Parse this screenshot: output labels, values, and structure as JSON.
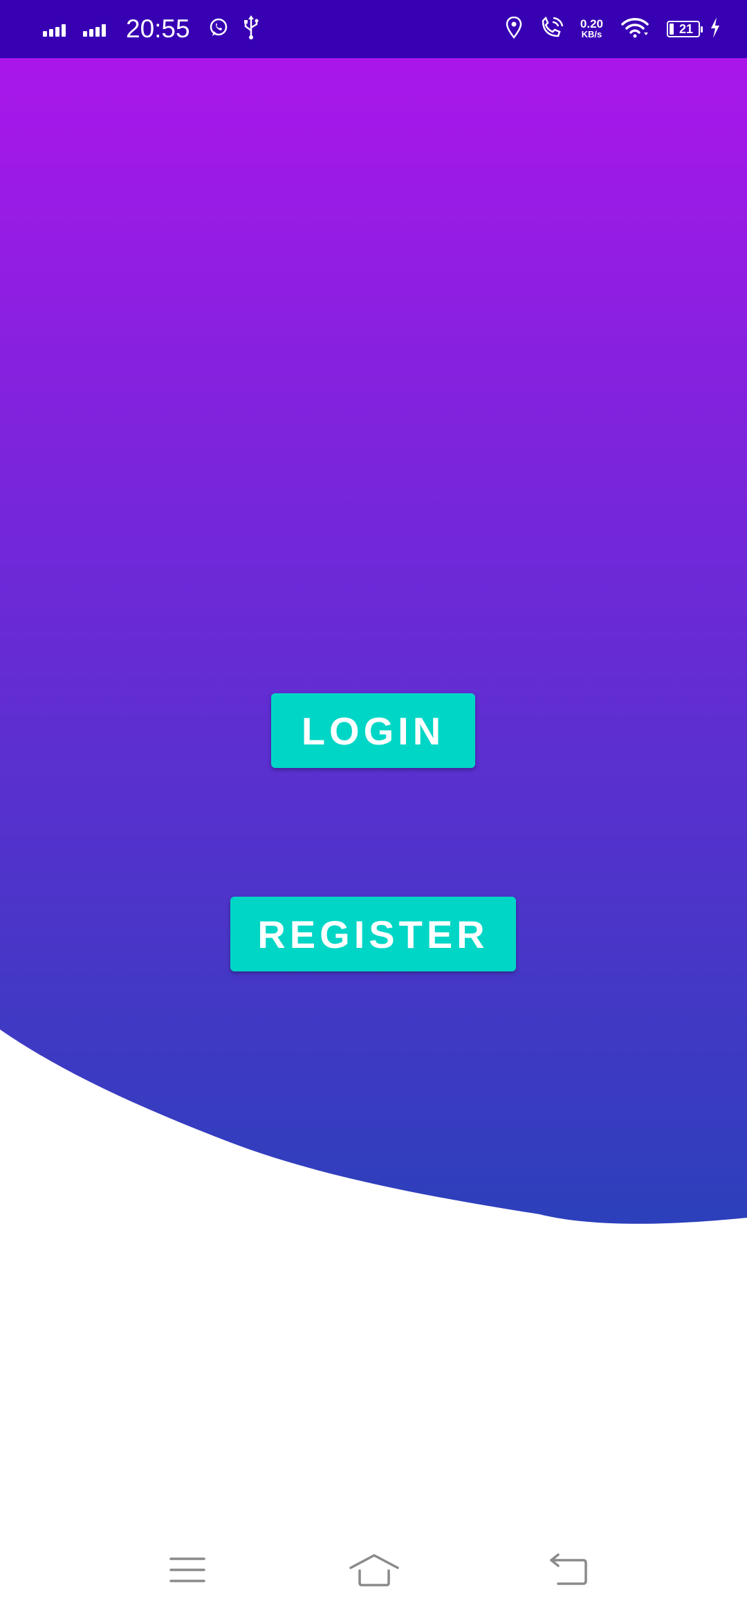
{
  "status_bar": {
    "time": "20:55",
    "net_speed_value": "0.20",
    "net_speed_unit": "KB/s",
    "battery_level": "21",
    "background_color": "#3800b3",
    "left_icons": [
      "signal-1-icon",
      "signal-2-icon",
      "whatsapp-icon",
      "usb-icon"
    ],
    "right_icons": [
      "location-icon",
      "wifi-calling-icon",
      "wifi-icon",
      "battery-icon",
      "charging-icon"
    ]
  },
  "hero": {
    "gradient_top_color": "#b014ec",
    "gradient_bottom_color": "#2c40bb"
  },
  "buttons": {
    "login_label": "LOGIN",
    "register_label": "REGISTER",
    "color": "#00d6c6"
  },
  "nav_bar": {
    "icons": [
      "menu-icon",
      "home-icon",
      "back-icon"
    ]
  }
}
